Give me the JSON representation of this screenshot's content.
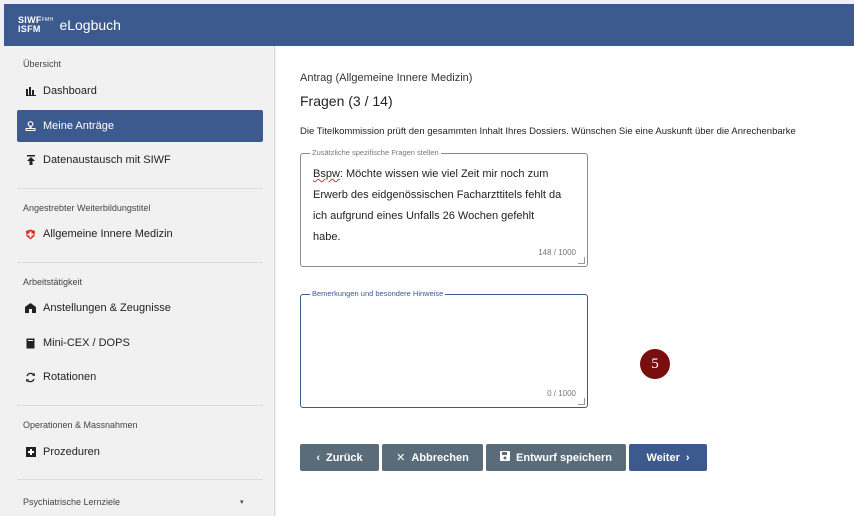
{
  "app": {
    "logo_top": "SIWF",
    "logo_top_small": "FMH",
    "logo_bottom": "ISFM",
    "title": "eLogbuch"
  },
  "sidebar": {
    "section_overview": "Übersicht",
    "dashboard": "Dashboard",
    "meine_antraege": "Meine Anträge",
    "datenaustausch": "Datenaustausch mit SIWF",
    "section_title": "Angestrebter Weiterbildungstitel",
    "title_item": "Allgemeine Innere Medizin",
    "section_work": "Arbeitstätigkeit",
    "anstellungen": "Anstellungen & Zeugnisse",
    "minicex": "Mini-CEX / DOPS",
    "rotationen": "Rotationen",
    "section_ops": "Operationen & Massnahmen",
    "prozeduren": "Prozeduren",
    "section_psych": "Psychiatrische Lernziele"
  },
  "main": {
    "breadcrumb": "Antrag (Allgemeine Innere Medizin)",
    "heading": "Fragen (3 / 14)",
    "intro": "Die Titelkommission prüft den gesammten Inhalt Ihres Dossiers. Wünschen Sie eine Auskunft über die Anrechenbarke",
    "field1": {
      "label": "Zusätzliche spezifische Fragen stellen",
      "value_word1": "Bspw",
      "value_rest": ": Möchte wissen wie viel Zeit mir noch zum Erwerb des eidgenössischen Facharzttitels fehlt da ich aufgrund eines Unfalls 26 Wochen gefehlt habe.",
      "counter": "148 / 1000"
    },
    "field2": {
      "label": "Bemerkungen und besondere Hinweise",
      "value": "",
      "counter": "0 / 1000"
    },
    "badge": "5",
    "buttons": {
      "back": "Zurück",
      "cancel": "Abbrechen",
      "save": "Entwurf speichern",
      "next": "Weiter"
    }
  },
  "colors": {
    "brand": "#3d5a8e",
    "badge": "#7a0d0d",
    "secondary_button": "#5a6b7a"
  }
}
